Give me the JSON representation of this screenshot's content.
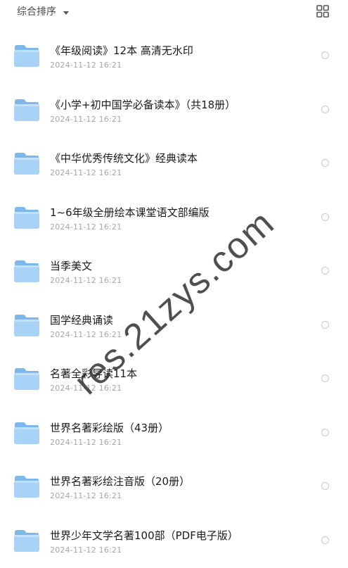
{
  "header": {
    "sort_label": "综合排序",
    "sort_icon": "caret-down-icon",
    "view_icon": "grid-view-icon"
  },
  "items": [
    {
      "name": "《年级阅读》12本 高清无水印",
      "date": "2024-11-12 16:21"
    },
    {
      "name": "《小学+初中国学必备读本》（共18册）",
      "date": "2024-11-12 16:21"
    },
    {
      "name": "《中华优秀传统文化》经典读本",
      "date": "2024-11-12 16:21"
    },
    {
      "name": "1~6年级全册绘本课堂语文部编版",
      "date": "2024-11-12 16:21"
    },
    {
      "name": "当季美文",
      "date": "2024-11-12 16:21"
    },
    {
      "name": "国学经典诵读",
      "date": "2024-11-12 16:21"
    },
    {
      "name": "名著全彩导读11本",
      "date": "2024-11-12 16:21"
    },
    {
      "name": "世界名著彩绘版（43册）",
      "date": "2024-11-12 16:21"
    },
    {
      "name": "世界名著彩绘注音版（20册）",
      "date": "2024-11-12 16:21"
    },
    {
      "name": "世界少年文学名著100部（PDF电子版）",
      "date": "2024-11-12 16:21"
    }
  ],
  "watermark": "res.21zys.com",
  "colors": {
    "folder_back": "#7db8ec",
    "folder_front": "#a9d2f7",
    "date_text": "#a6a6a6",
    "radio_border": "#c9c9c9"
  }
}
